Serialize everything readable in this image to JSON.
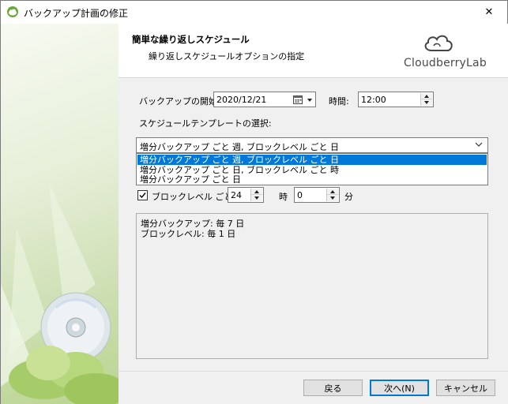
{
  "window": {
    "title": "バックアップ計画の修正",
    "close_symbol": "✕"
  },
  "header": {
    "title": "簡単な繰り返しスケジュール",
    "subtitle": "繰り返しスケジュールオプションの指定",
    "logo_text": "CloudberryLab"
  },
  "backup_start": {
    "label": "バックアップの開始:",
    "date_value": "2020/12/21",
    "time_label": "時間:",
    "time_value": "12:00"
  },
  "template": {
    "label": "スケジュールテンプレートの選択:",
    "selected": "増分バックアップ ごと 週, ブロックレベル ごと 日",
    "options": [
      "増分バックアップ ごと 週, ブロックレベル ごと 日",
      "増分バックアップ ごと 日, ブロックレベル ごと 時",
      "増分バックアップ ごと 日"
    ],
    "highlighted_index": 0
  },
  "block_level": {
    "checked": true,
    "label": "ブロックレベル ごと :",
    "hours_value": "24",
    "hours_label": "時",
    "minutes_value": "0",
    "minutes_label": "分"
  },
  "summary": {
    "lines": [
      "増分バックアップ: 毎 7 日",
      "ブロックレベル: 毎 1 日"
    ]
  },
  "buttons": {
    "back": "戻る",
    "next": "次へ(N)",
    "cancel": "キャンセル"
  },
  "colors": {
    "selection": "#0078d7",
    "panel_bg": "#f0f0f0",
    "button_bg": "#e1e1e1"
  }
}
